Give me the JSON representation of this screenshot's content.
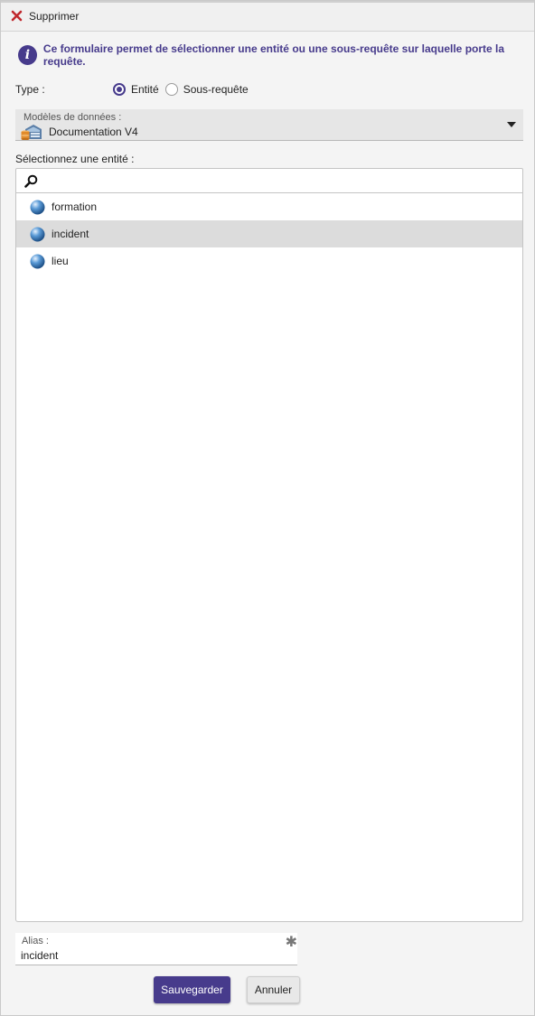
{
  "toolbar": {
    "delete_label": "Supprimer",
    "delete_icon": "close-icon",
    "delete_icon_color": "#c0282d"
  },
  "info": {
    "icon": "info-icon",
    "text": "Ce formulaire permet de sélectionner une entité ou une sous-requête sur laquelle porte la requête."
  },
  "type": {
    "label": "Type :",
    "options": [
      {
        "label": "Entité",
        "checked": true
      },
      {
        "label": "Sous-requête",
        "checked": false
      }
    ]
  },
  "model": {
    "label": "Modèles de données :",
    "value": "Documentation V4",
    "icon": "data-model-icon"
  },
  "entities": {
    "heading": "Sélectionnez une entité :",
    "search_placeholder": "",
    "items": [
      {
        "label": "formation",
        "selected": false
      },
      {
        "label": "incident",
        "selected": true
      },
      {
        "label": "lieu",
        "selected": false
      }
    ]
  },
  "alias": {
    "label": "Alias :",
    "value": "incident",
    "required_icon": "asterisk-icon"
  },
  "actions": {
    "save_label": "Sauvegarder",
    "cancel_label": "Annuler"
  },
  "colors": {
    "accent": "#473b8c",
    "selected_row": "#dcdcdc"
  }
}
